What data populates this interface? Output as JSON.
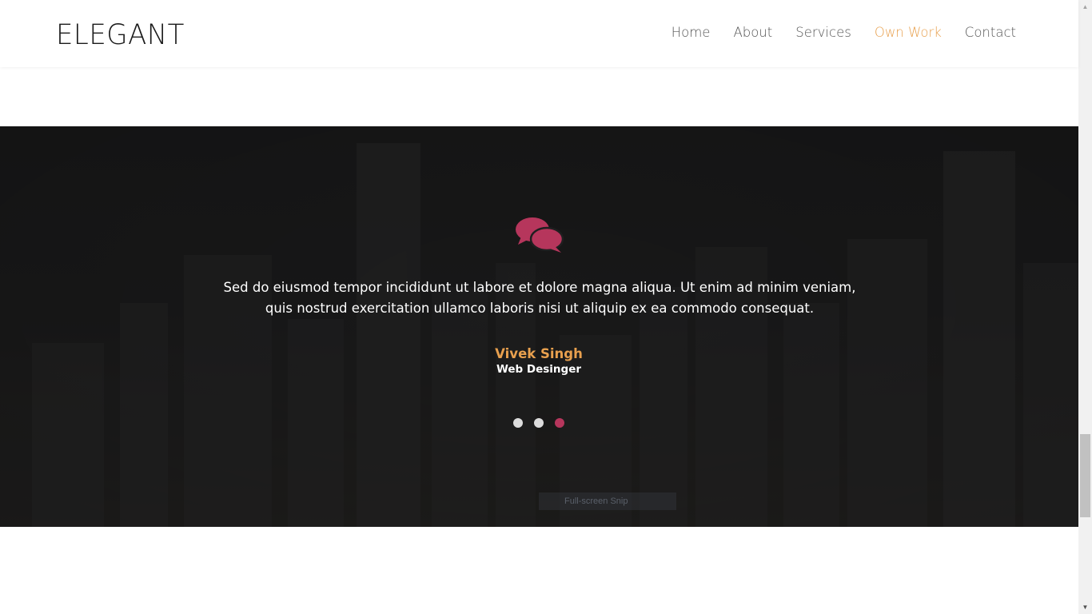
{
  "header": {
    "logo": "ELEGANT",
    "nav": [
      {
        "label": "Home",
        "active": false
      },
      {
        "label": "About",
        "active": false
      },
      {
        "label": "Services",
        "active": false
      },
      {
        "label": "Own Work",
        "active": true
      },
      {
        "label": "Contact",
        "active": false
      }
    ],
    "accent_color": "#e8a04e"
  },
  "testimonial": {
    "icon": "chat-bubbles-icon",
    "icon_color": "#b6365c",
    "quote": "Sed do eiusmod tempor incididunt ut labore et dolore magna aliqua. Ut enim ad minim veniam, quis nostrud exercitation ullamco laboris nisi ut aliquip ex ea commodo consequat.",
    "name": "Vivek Singh",
    "role": "Web Desinger",
    "slide_count": 3,
    "active_slide": 3
  },
  "overlay_text": "Full-screen Snip"
}
